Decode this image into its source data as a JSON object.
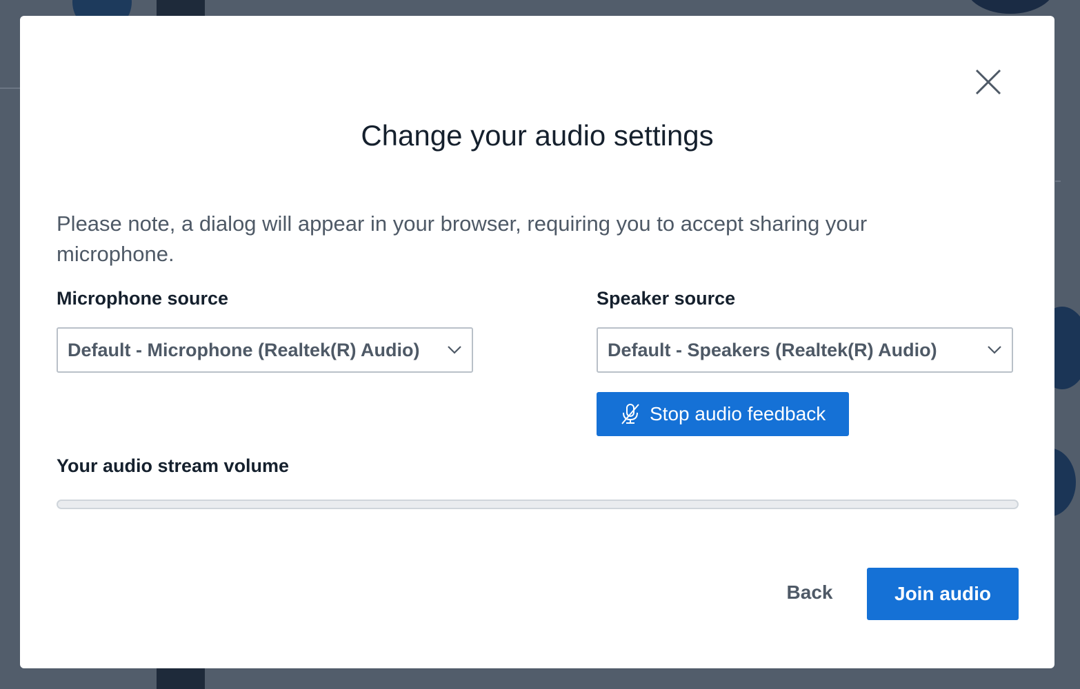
{
  "dialog": {
    "title": "Change your audio settings",
    "note": "Please note, a dialog will appear in your browser, requiring you to accept sharing your microphone.",
    "close_icon": "close-icon"
  },
  "microphone": {
    "label": "Microphone source",
    "selected": "Default - Microphone (Realtek(R) Audio)"
  },
  "speaker": {
    "label": "Speaker source",
    "selected": "Default - Speakers (Realtek(R) Audio)"
  },
  "feedback_button": {
    "label": "Stop audio feedback",
    "icon": "mic-off-icon"
  },
  "volume": {
    "label": "Your audio stream volume",
    "level": 0
  },
  "actions": {
    "back_label": "Back",
    "join_label": "Join audio"
  },
  "colors": {
    "accent": "#1571d6",
    "title_text": "#15202d",
    "muted_text": "#4e5966",
    "overlay": "#525d6b"
  }
}
